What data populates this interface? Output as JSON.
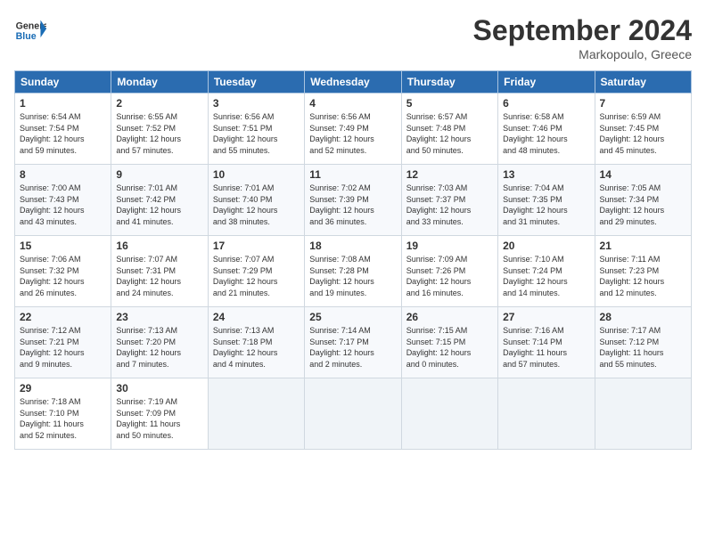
{
  "logo": {
    "line1": "General",
    "line2": "Blue"
  },
  "title": "September 2024",
  "location": "Markopoulo, Greece",
  "days_header": [
    "Sunday",
    "Monday",
    "Tuesday",
    "Wednesday",
    "Thursday",
    "Friday",
    "Saturday"
  ],
  "weeks": [
    [
      {
        "num": "1",
        "info": "Sunrise: 6:54 AM\nSunset: 7:54 PM\nDaylight: 12 hours\nand 59 minutes."
      },
      {
        "num": "2",
        "info": "Sunrise: 6:55 AM\nSunset: 7:52 PM\nDaylight: 12 hours\nand 57 minutes."
      },
      {
        "num": "3",
        "info": "Sunrise: 6:56 AM\nSunset: 7:51 PM\nDaylight: 12 hours\nand 55 minutes."
      },
      {
        "num": "4",
        "info": "Sunrise: 6:56 AM\nSunset: 7:49 PM\nDaylight: 12 hours\nand 52 minutes."
      },
      {
        "num": "5",
        "info": "Sunrise: 6:57 AM\nSunset: 7:48 PM\nDaylight: 12 hours\nand 50 minutes."
      },
      {
        "num": "6",
        "info": "Sunrise: 6:58 AM\nSunset: 7:46 PM\nDaylight: 12 hours\nand 48 minutes."
      },
      {
        "num": "7",
        "info": "Sunrise: 6:59 AM\nSunset: 7:45 PM\nDaylight: 12 hours\nand 45 minutes."
      }
    ],
    [
      {
        "num": "8",
        "info": "Sunrise: 7:00 AM\nSunset: 7:43 PM\nDaylight: 12 hours\nand 43 minutes."
      },
      {
        "num": "9",
        "info": "Sunrise: 7:01 AM\nSunset: 7:42 PM\nDaylight: 12 hours\nand 41 minutes."
      },
      {
        "num": "10",
        "info": "Sunrise: 7:01 AM\nSunset: 7:40 PM\nDaylight: 12 hours\nand 38 minutes."
      },
      {
        "num": "11",
        "info": "Sunrise: 7:02 AM\nSunset: 7:39 PM\nDaylight: 12 hours\nand 36 minutes."
      },
      {
        "num": "12",
        "info": "Sunrise: 7:03 AM\nSunset: 7:37 PM\nDaylight: 12 hours\nand 33 minutes."
      },
      {
        "num": "13",
        "info": "Sunrise: 7:04 AM\nSunset: 7:35 PM\nDaylight: 12 hours\nand 31 minutes."
      },
      {
        "num": "14",
        "info": "Sunrise: 7:05 AM\nSunset: 7:34 PM\nDaylight: 12 hours\nand 29 minutes."
      }
    ],
    [
      {
        "num": "15",
        "info": "Sunrise: 7:06 AM\nSunset: 7:32 PM\nDaylight: 12 hours\nand 26 minutes."
      },
      {
        "num": "16",
        "info": "Sunrise: 7:07 AM\nSunset: 7:31 PM\nDaylight: 12 hours\nand 24 minutes."
      },
      {
        "num": "17",
        "info": "Sunrise: 7:07 AM\nSunset: 7:29 PM\nDaylight: 12 hours\nand 21 minutes."
      },
      {
        "num": "18",
        "info": "Sunrise: 7:08 AM\nSunset: 7:28 PM\nDaylight: 12 hours\nand 19 minutes."
      },
      {
        "num": "19",
        "info": "Sunrise: 7:09 AM\nSunset: 7:26 PM\nDaylight: 12 hours\nand 16 minutes."
      },
      {
        "num": "20",
        "info": "Sunrise: 7:10 AM\nSunset: 7:24 PM\nDaylight: 12 hours\nand 14 minutes."
      },
      {
        "num": "21",
        "info": "Sunrise: 7:11 AM\nSunset: 7:23 PM\nDaylight: 12 hours\nand 12 minutes."
      }
    ],
    [
      {
        "num": "22",
        "info": "Sunrise: 7:12 AM\nSunset: 7:21 PM\nDaylight: 12 hours\nand 9 minutes."
      },
      {
        "num": "23",
        "info": "Sunrise: 7:13 AM\nSunset: 7:20 PM\nDaylight: 12 hours\nand 7 minutes."
      },
      {
        "num": "24",
        "info": "Sunrise: 7:13 AM\nSunset: 7:18 PM\nDaylight: 12 hours\nand 4 minutes."
      },
      {
        "num": "25",
        "info": "Sunrise: 7:14 AM\nSunset: 7:17 PM\nDaylight: 12 hours\nand 2 minutes."
      },
      {
        "num": "26",
        "info": "Sunrise: 7:15 AM\nSunset: 7:15 PM\nDaylight: 12 hours\nand 0 minutes."
      },
      {
        "num": "27",
        "info": "Sunrise: 7:16 AM\nSunset: 7:14 PM\nDaylight: 11 hours\nand 57 minutes."
      },
      {
        "num": "28",
        "info": "Sunrise: 7:17 AM\nSunset: 7:12 PM\nDaylight: 11 hours\nand 55 minutes."
      }
    ],
    [
      {
        "num": "29",
        "info": "Sunrise: 7:18 AM\nSunset: 7:10 PM\nDaylight: 11 hours\nand 52 minutes."
      },
      {
        "num": "30",
        "info": "Sunrise: 7:19 AM\nSunset: 7:09 PM\nDaylight: 11 hours\nand 50 minutes."
      },
      null,
      null,
      null,
      null,
      null
    ]
  ]
}
